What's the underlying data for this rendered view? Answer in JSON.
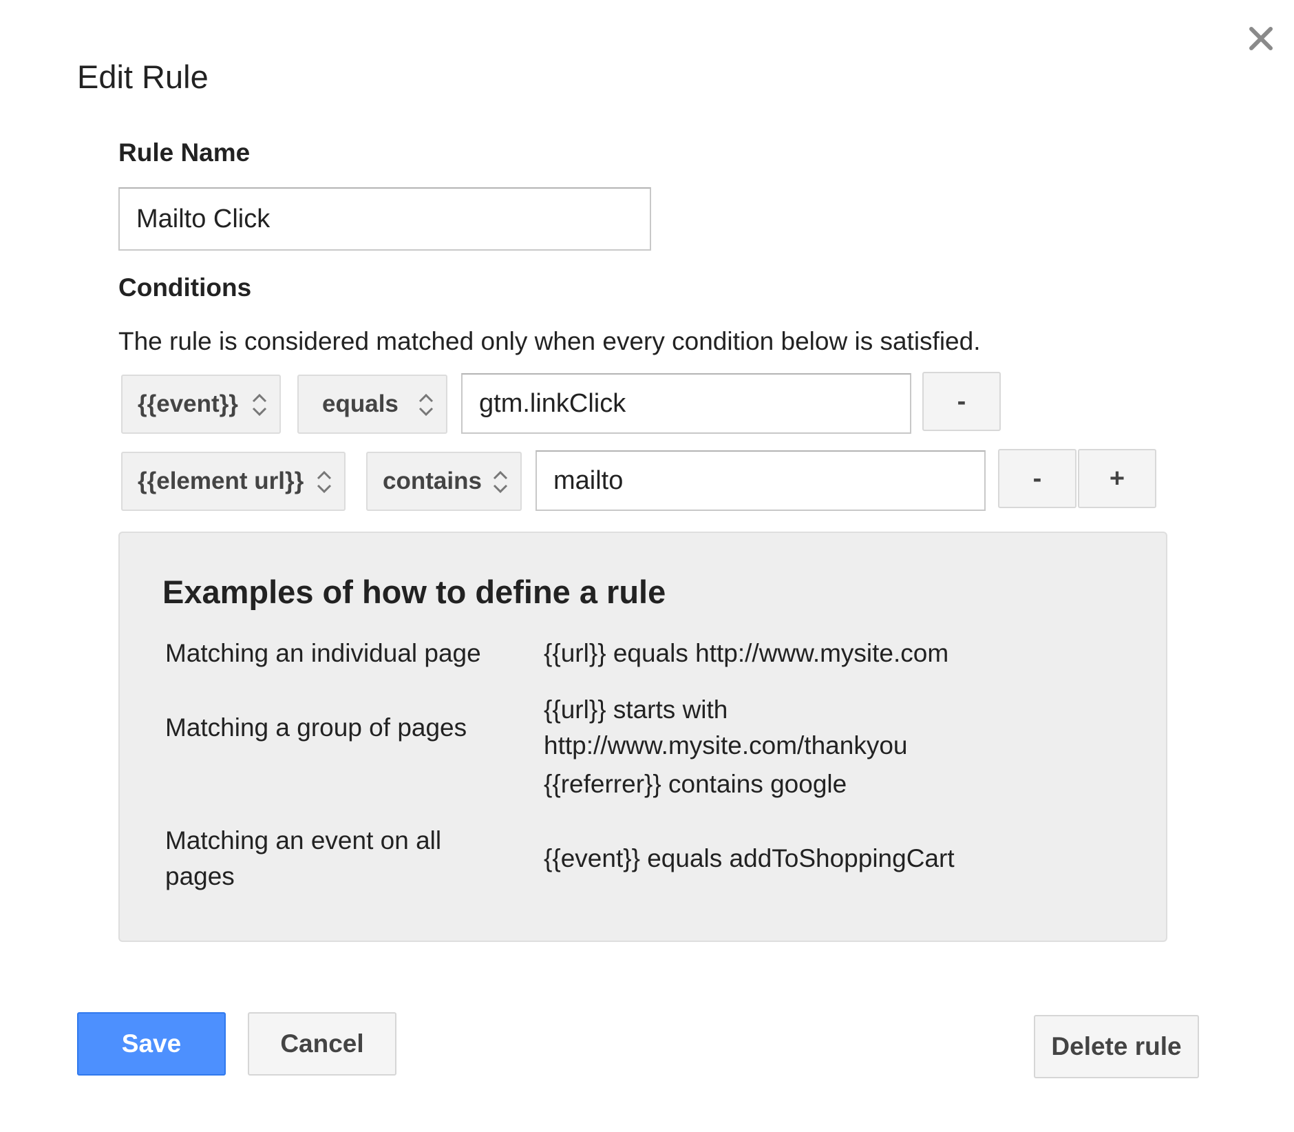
{
  "dialog": {
    "title": "Edit Rule",
    "close_icon": "close-icon"
  },
  "rule_name": {
    "label": "Rule Name",
    "value": "Mailto Click"
  },
  "conditions": {
    "label": "Conditions",
    "help": "The rule is considered matched only when every condition below is satisfied.",
    "rows": [
      {
        "variable": "{{event}}",
        "operator": "equals",
        "value": "gtm.linkClick",
        "remove_label": "-"
      },
      {
        "variable": "{{element url}}",
        "operator": "contains",
        "value": "mailto",
        "remove_label": "-",
        "add_label": "+"
      }
    ]
  },
  "examples": {
    "title": "Examples of how to define a rule",
    "items": [
      {
        "label": "Matching an individual page",
        "values": [
          "{{url}} equals http://www.mysite.com"
        ]
      },
      {
        "label": "Matching a group of pages",
        "values": [
          "{{url}} starts with",
          "http://www.mysite.com/thankyou",
          "{{referrer}} contains google"
        ]
      },
      {
        "label_lines": [
          "Matching an event on all",
          "pages"
        ],
        "values": [
          "{{event}} equals addToShoppingCart"
        ]
      }
    ]
  },
  "footer": {
    "save_label": "Save",
    "cancel_label": "Cancel",
    "delete_label": "Delete rule"
  }
}
